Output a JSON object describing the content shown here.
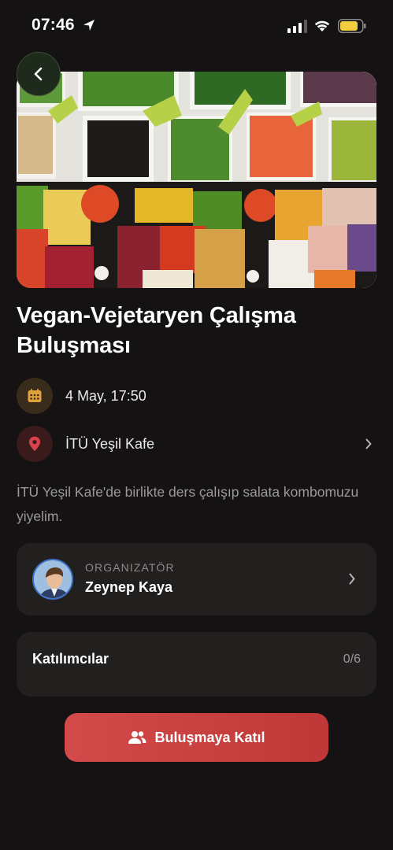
{
  "status_bar": {
    "time": "07:46"
  },
  "event": {
    "title": "Vegan-Vejetaryen Çalışma Buluşması",
    "date": "4 May, 17:50",
    "location": "İTÜ Yeşil Kafe",
    "description": "İTÜ Yeşil Kafe'de birlikte ders çalışıp salata kombomuzu yiyelim."
  },
  "organizer": {
    "label": "ORGANIZATÖR",
    "name": "Zeynep Kaya"
  },
  "participants": {
    "label": "Katılımcılar",
    "count": "0/6"
  },
  "actions": {
    "join_label": "Buluşmaya Katıl"
  },
  "icons": {
    "back": "chevron-left-icon",
    "date": "calendar-icon",
    "location": "map-pin-icon",
    "join": "users-icon"
  },
  "colors": {
    "background": "#141212",
    "card": "#221f1f",
    "accent_red": "#cf4444",
    "calendar_accent": "#e0a23a",
    "pin_accent": "#d9424a",
    "muted_text": "#9c9a99"
  }
}
